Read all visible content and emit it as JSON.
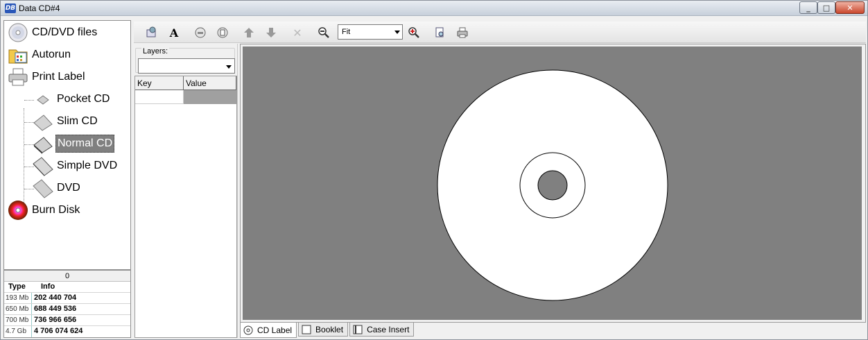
{
  "window": {
    "title": "Data CD#4",
    "app_icon_text": "DB",
    "buttons": {
      "minimize": "_",
      "maximize": "□",
      "close": "✕"
    }
  },
  "tree": {
    "items": [
      {
        "label": "CD/DVD files",
        "icon": "cd-icon"
      },
      {
        "label": "Autorun",
        "icon": "autorun-folder-icon"
      },
      {
        "label": "Print Label",
        "icon": "printer-icon"
      },
      {
        "label": "Pocket CD",
        "icon": "pocket-cd-case-icon"
      },
      {
        "label": "Slim CD",
        "icon": "slim-cd-case-icon"
      },
      {
        "label": "Normal CD",
        "icon": "normal-cd-case-icon",
        "selected": true
      },
      {
        "label": "Simple DVD",
        "icon": "simple-dvd-case-icon"
      },
      {
        "label": "DVD",
        "icon": "dvd-case-icon"
      },
      {
        "label": "Burn Disk",
        "icon": "burn-disk-icon"
      }
    ]
  },
  "info": {
    "counter": "0",
    "headers": {
      "type": "Type",
      "info": "Info"
    },
    "rows": [
      {
        "type": "193 Mb",
        "info": "202 440 704"
      },
      {
        "type": "650 Mb",
        "info": "688 449 536"
      },
      {
        "type": "700 Mb",
        "info": "736 966 656"
      },
      {
        "type": "4.7 Gb",
        "info": "4 706 074 624"
      }
    ]
  },
  "toolbar": {
    "zoom_value": "Fit",
    "icons": [
      "add-image-icon",
      "text-icon",
      "cd-layer-icon",
      "layer-list-icon",
      "move-up-icon",
      "move-down-icon",
      "delete-icon",
      "zoom-out-icon",
      "zoom-in-icon",
      "print-preview-icon",
      "print-icon"
    ]
  },
  "layers": {
    "legend": "Layers:",
    "selected": "",
    "grid_headers": {
      "key": "Key",
      "value": "Value"
    }
  },
  "tabs": [
    {
      "label": "CD Label",
      "active": true
    },
    {
      "label": "Booklet",
      "active": false
    },
    {
      "label": "Case Insert",
      "active": false
    }
  ],
  "colors": {
    "canvas_bg": "#808080",
    "disc": "#ffffff",
    "selection": "#808080"
  }
}
